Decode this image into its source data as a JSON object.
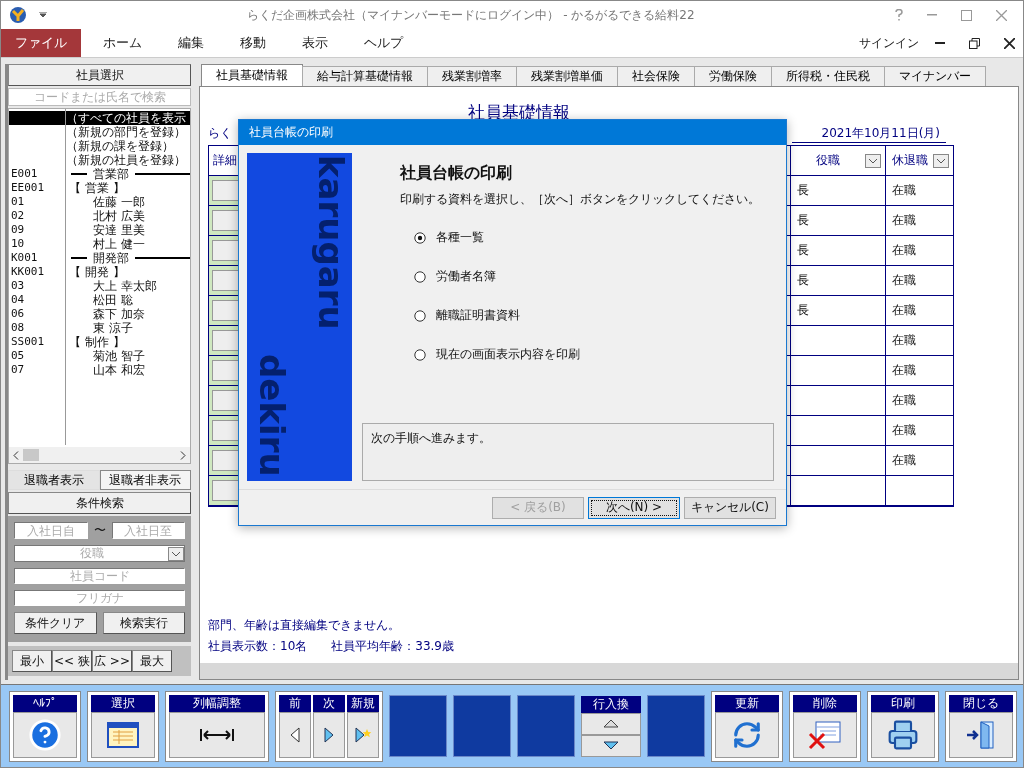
{
  "window": {
    "title": "らくだ企画株式会社（マイナンバーモードにログイン中） - かるがるできる給料22"
  },
  "menu": [
    {
      "label": "ファイル",
      "selected": true
    },
    {
      "label": "ホーム",
      "selected": false
    },
    {
      "label": "編集",
      "selected": false
    },
    {
      "label": "移動",
      "selected": false
    },
    {
      "label": "表示",
      "selected": false
    },
    {
      "label": "ヘルプ",
      "selected": false
    }
  ],
  "account": {
    "label": "サインイン"
  },
  "employee_panel": {
    "header": "社員選択",
    "search": {
      "placeholder": "コードまたは氏名で検索"
    },
    "actions": [
      {
        "label": "（すべての社員を表示",
        "selected": true
      },
      {
        "label": "（新規の部門を登録）",
        "selected": false
      },
      {
        "label": "（新規の課を登録）",
        "selected": false
      },
      {
        "label": "（新規の社員を登録）",
        "selected": false
      }
    ],
    "departments": [
      {
        "code": "E001",
        "name": "営業部",
        "selected": false,
        "children": [
          {
            "code": "EE001",
            "name": "【 営業 】",
            "selected": false,
            "children": [
              {
                "code": "01",
                "name": "佐藤 一郎",
                "selected": false
              },
              {
                "code": "02",
                "name": "北村 広美",
                "selected": false
              },
              {
                "code": "09",
                "name": "安達 里美",
                "selected": false
              },
              {
                "code": "10",
                "name": "村上 健一",
                "selected": false
              }
            ]
          }
        ]
      },
      {
        "code": "K001",
        "name": "開発部",
        "selected": false,
        "children": [
          {
            "code": "KK001",
            "name": "【 開発 】",
            "selected": false,
            "children": [
              {
                "code": "03",
                "name": "大上 幸太郎",
                "selected": false
              },
              {
                "code": "04",
                "name": "松田 聡",
                "selected": false
              },
              {
                "code": "06",
                "name": "森下 加奈",
                "selected": false
              },
              {
                "code": "08",
                "name": "東 涼子",
                "selected": false
              }
            ]
          },
          {
            "code": "SS001",
            "name": "【 制作 】",
            "selected": false,
            "children": [
              {
                "code": "05",
                "name": "菊池 智子",
                "selected": false
              },
              {
                "code": "07",
                "name": "山本 和宏",
                "selected": false
              }
            ]
          }
        ]
      }
    ]
  },
  "retired_tabs": [
    {
      "label": "退職者表示",
      "selected": true
    },
    {
      "label": "退職者非表示",
      "selected": false
    }
  ],
  "condition_search": {
    "header": "条件検索",
    "hire_from": {
      "placeholder": "入社日自"
    },
    "tilde": "〜",
    "hire_to": {
      "placeholder": "入社日至"
    },
    "position": {
      "placeholder": "役職"
    },
    "code": {
      "placeholder": "社員コード"
    },
    "kana": {
      "placeholder": "フリガナ"
    },
    "buttons": [
      "条件クリア",
      "検索実行"
    ]
  },
  "width_buttons": [
    "最小",
    "<< 狭",
    "広 >>",
    "最大"
  ],
  "tabs": [
    {
      "label": "社員基礎情報",
      "selected": true
    },
    {
      "label": "給与計算基礎情報",
      "selected": false
    },
    {
      "label": "残業割増率",
      "selected": false
    },
    {
      "label": "残業割増単価",
      "selected": false
    },
    {
      "label": "社会保険",
      "selected": false
    },
    {
      "label": "労働保険",
      "selected": false
    },
    {
      "label": "所得税・住民税",
      "selected": false
    },
    {
      "label": "マイナンバー",
      "selected": false
    }
  ],
  "sheet": {
    "title": "社員基礎情報",
    "company": "らく",
    "date": "2021年10月11日(月)",
    "columns": [
      "詳細",
      "役職",
      "休退職"
    ],
    "rows": [
      {
        "position": "長",
        "status": "在職"
      },
      {
        "position": "長",
        "status": "在職"
      },
      {
        "position": "長",
        "status": "在職"
      },
      {
        "position": "長",
        "status": "在職"
      },
      {
        "position": "長",
        "status": "在職"
      },
      {
        "status": "在職"
      },
      {
        "status": "在職"
      },
      {
        "status": "在職"
      },
      {
        "status": "在職"
      },
      {
        "status": "在職"
      },
      {}
    ],
    "note": "部門、年齢は直接編集できません。",
    "count": "社員表示数：10名",
    "average": "社員平均年齢：33.9歳"
  },
  "dialog": {
    "title": "社員台帳の印刷",
    "banner": [
      "karugaru",
      "dekiru"
    ],
    "heading": "社員台帳の印刷",
    "instruction": "印刷する資料を選択し、［次へ］ボタンをクリックしてください。",
    "options": [
      {
        "label": "各種一覧",
        "selected": true
      },
      {
        "label": "労働者名簿",
        "selected": false
      },
      {
        "label": "離職証明書資料",
        "selected": false
      },
      {
        "label": "現在の画面表示内容を印刷",
        "selected": false
      }
    ],
    "message": "次の手順へ進みます。",
    "buttons": [
      {
        "label": "< 戻る(B)",
        "disabled": true,
        "default": false
      },
      {
        "label": "次へ(N) >",
        "disabled": false,
        "default": true
      },
      {
        "label": "キャンセル(C)",
        "disabled": false,
        "default": false
      }
    ]
  },
  "toolbar": [
    {
      "kind": "help",
      "label": "ﾍﾙﾌﾟ"
    },
    {
      "kind": "select",
      "label": "選択"
    },
    {
      "kind": "width",
      "label": "列幅調整"
    },
    {
      "kind": "nav",
      "items": [
        {
          "kind": "prev",
          "label": "前"
        },
        {
          "kind": "next",
          "label": "次"
        },
        {
          "kind": "new",
          "label": "新規"
        }
      ]
    },
    {
      "kind": "blank"
    },
    {
      "kind": "blank"
    },
    {
      "kind": "blank"
    },
    {
      "kind": "swap",
      "label": "行入換"
    },
    {
      "kind": "blank"
    },
    {
      "kind": "refresh",
      "label": "更新"
    },
    {
      "kind": "delete",
      "label": "削除"
    },
    {
      "kind": "print",
      "label": "印刷"
    },
    {
      "kind": "close",
      "label": "閉じる"
    }
  ]
}
